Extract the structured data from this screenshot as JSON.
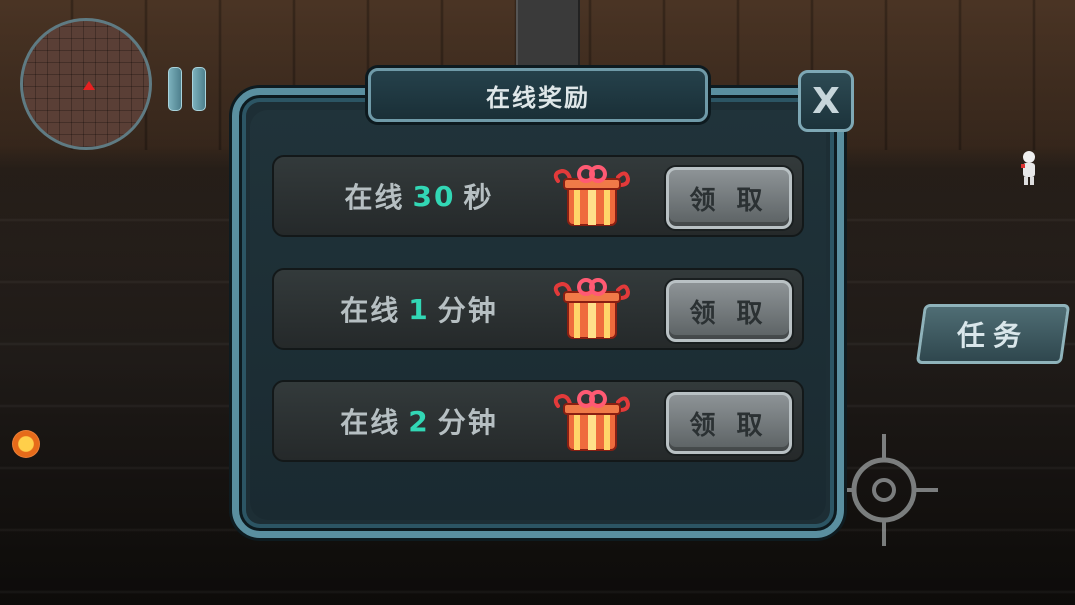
{
  "dialog": {
    "title": "在线奖励",
    "close_label": "X",
    "rewards": [
      {
        "prefix": "在线",
        "amount": "30",
        "unit": "秒",
        "claim_label": "领 取",
        "icon": "gift-box-icon"
      },
      {
        "prefix": "在线",
        "amount": "1",
        "unit": "分钟",
        "claim_label": "领 取",
        "icon": "gift-box-icon"
      },
      {
        "prefix": "在线",
        "amount": "2",
        "unit": "分钟",
        "claim_label": "领 取",
        "icon": "gift-box-icon"
      }
    ]
  },
  "hud": {
    "task_label": "任务",
    "minimap_icon": "minimap",
    "pause_icon": "pause-icon",
    "crosshair_icon": "crosshair-icon"
  },
  "colors": {
    "accent_number": "#32d7b5",
    "frame": "#5a8fa0",
    "player_marker": "#e82020"
  }
}
